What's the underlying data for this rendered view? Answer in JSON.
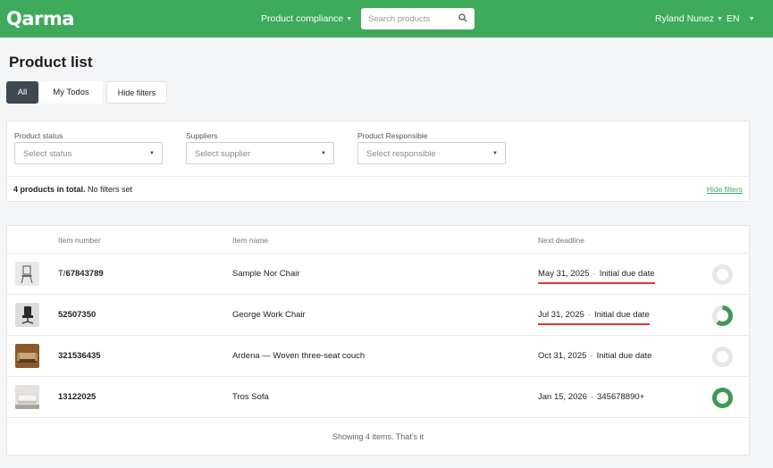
{
  "header": {
    "logo_text": "Qarma",
    "nav_compliance": "Product compliance",
    "search_placeholder": "Search products",
    "user_name": "Ryland Nunez",
    "language": "EN",
    "brand_color": "#3daa5c"
  },
  "page": {
    "title": "Product list",
    "tabs": [
      "All",
      "My Todos",
      "Hide filters"
    ]
  },
  "filters": {
    "status_label": "Product status",
    "status_placeholder": "Select status",
    "suppliers_label": "Suppliers",
    "suppliers_placeholder": "Select supplier",
    "responsible_label": "Product Responsible",
    "responsible_placeholder": "Select responsible",
    "total_bold": "4 products in total.",
    "total_rest": " No filters set",
    "hide_link": "Hide filters"
  },
  "table": {
    "columns": [
      "Item number",
      "Item name",
      "Next deadline"
    ],
    "rows": [
      {
        "prefix": "T/",
        "item_number": "67843789",
        "item_name": "Sample Nor Chair",
        "deadline_date": "May 31, 2025",
        "deadline_label": "Initial due date",
        "urgent": true,
        "progress": 0,
        "thumb": "chair-light"
      },
      {
        "prefix": "",
        "item_number": "52507350",
        "item_name": "George Work Chair",
        "deadline_date": "Jul 31, 2025",
        "deadline_label": "Initial due date",
        "urgent": true,
        "progress": 0.6,
        "thumb": "chair-office"
      },
      {
        "prefix": "",
        "item_number": "321536435",
        "item_name": "Ardena — Woven three-seat couch",
        "deadline_date": "Oct 31, 2025",
        "deadline_label": "Initial due date",
        "urgent": false,
        "progress": 0,
        "thumb": "couch-brown"
      },
      {
        "prefix": "",
        "item_number": "13122025",
        "item_name": "Tros Sofa",
        "deadline_date": "Jan 15, 2026",
        "deadline_label": "345678890+",
        "urgent": false,
        "progress": 1,
        "thumb": "sofa-light"
      }
    ],
    "footer": "Showing 4 items. That's it"
  }
}
